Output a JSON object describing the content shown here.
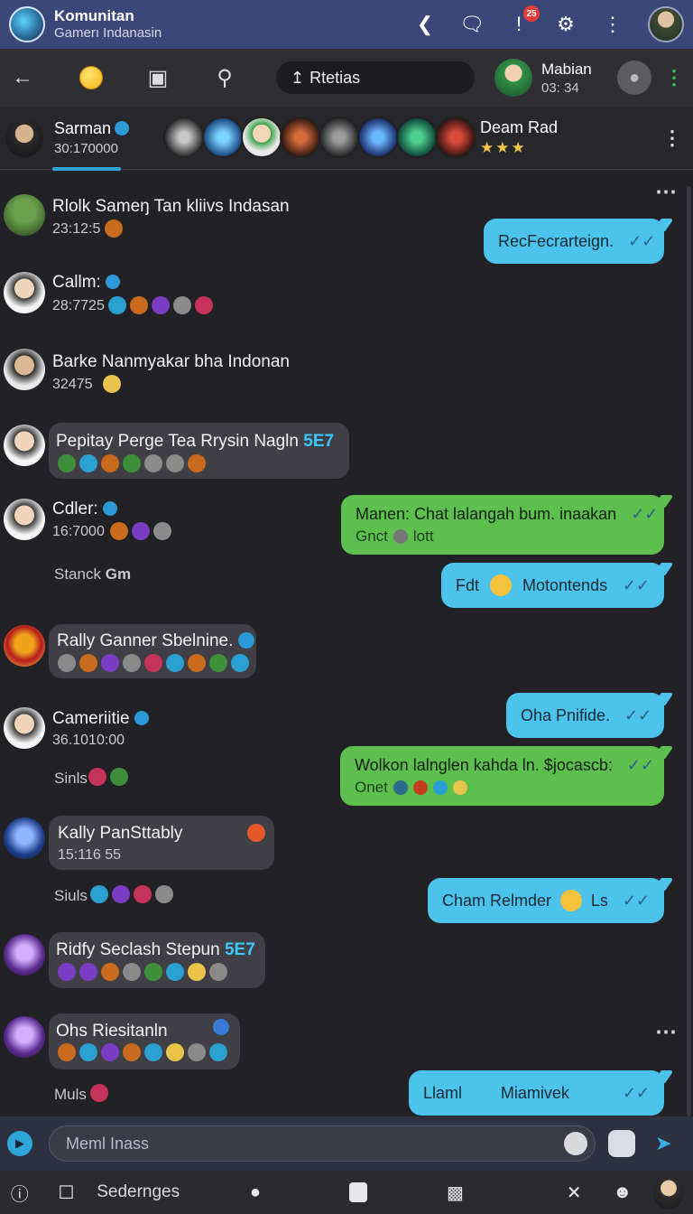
{
  "appbar": {
    "title": "Komunitan",
    "subtitle": "Gamerı Indanasin",
    "badge_count": "25"
  },
  "toolbar": {
    "search_pill": "Rtetias",
    "user_name": "Mabian",
    "user_time": "03: 34"
  },
  "members": {
    "name": "Sarman",
    "number": "30:170000",
    "strip_name": "Deam Rad",
    "stars": "★★★"
  },
  "messages": {
    "m1": {
      "name": "Rlolk Sameŋ Tan kliivs Indasan",
      "sub": "23:12:5"
    },
    "m1_reply": "RecFecrarteign.",
    "m2": {
      "name": "Callm:",
      "sub": "28:7725"
    },
    "m3": {
      "name": "Barke Nanmyakar bha Indonan",
      "sub": "32475"
    },
    "m4": {
      "name": "Pepitay Perge Tea Rrysin Nagln",
      "tag": "5E7"
    },
    "m5": {
      "name": "Cdler:",
      "sub": "16:7000"
    },
    "m5_reply": {
      "line1": "Manen: Chat lalangah bum. inaakan",
      "line2": "Gnct",
      "line2b": "lott"
    },
    "m5_side": "Stanck",
    "m5_side_b": "Gm",
    "m5_reply2": {
      "left": "Fdt",
      "right": "Motontends"
    },
    "m6": {
      "name": "Rally Ganner Sbelnine."
    },
    "m7": {
      "name": "Cameriitie",
      "sub": "36.1010:00"
    },
    "m7_reply": "Oha Pnifide.",
    "m7_reply2": {
      "line1": "Wolkon lalnglen kahda ln. $jocascb:",
      "line2": "Onet"
    },
    "m7_side": "Sinls",
    "m8": {
      "name": "Kally PanSttably",
      "sub": "15:116 55"
    },
    "m8_side": "Siuls",
    "m8_reply": {
      "left": "Cham Relmder",
      "right": "Ls"
    },
    "m9": {
      "name": "Ridfy Seclash Stepun",
      "tag": "5E7"
    },
    "m10": {
      "name": "Ohs Riesitanln"
    },
    "m10_side": "Muls",
    "m10_reply": {
      "left": "Llaml",
      "right": "Miamivek"
    }
  },
  "composer": {
    "placeholder": "Meml Inass"
  },
  "bottomnav": {
    "label": "Sedernges"
  }
}
